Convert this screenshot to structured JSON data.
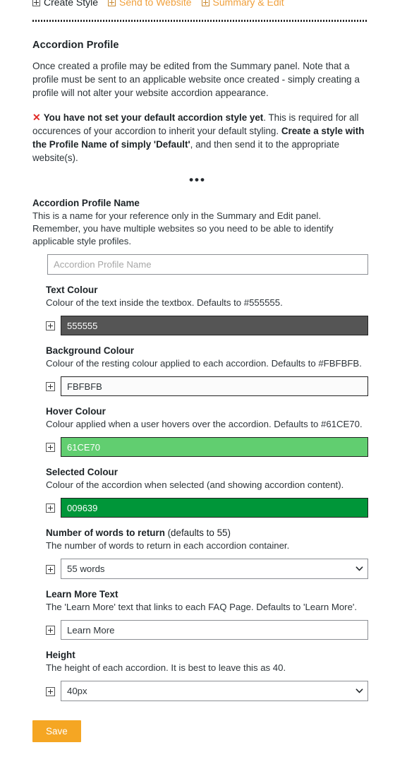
{
  "tabs": [
    {
      "label": "Create Style",
      "icon": "plus-box-icon",
      "active": true
    },
    {
      "label": "Send to Website",
      "icon": "plus-box-icon",
      "active": false
    },
    {
      "label": "Summary & Edit",
      "icon": "plus-box-icon",
      "active": false
    }
  ],
  "section": {
    "title": "Accordion Profile",
    "intro": "Once created a profile may be edited from the Summary panel. Note that a profile must be sent to an applicable website once created - simply creating a profile will not alter your website accordion appearance.",
    "divider_dots": "•••"
  },
  "alert": {
    "mark": "✕",
    "bold_1": "You have not set your default accordion style yet",
    "text_1": ". This is required for all occurences of your accordion to inherit your default styling. ",
    "bold_2": "Create a style with the Profile Name of simply 'Default'",
    "text_2": ", and then send it to the appropriate website(s)."
  },
  "fields": {
    "profile_name": {
      "label": "Accordion Profile Name",
      "help": "This is a name for your reference only in the Summary and Edit panel. Remember, you have multiple websites so you need to be able to identify applicable style profiles.",
      "placeholder": "Accordion Profile Name",
      "value": ""
    },
    "text_colour": {
      "label": "Text Colour",
      "help": "Colour of the text inside the textbox. Defaults to #555555.",
      "value": "555555",
      "swatch": "#555555",
      "text_colour": "#ffffff"
    },
    "background_colour": {
      "label": "Background Colour",
      "help": "Colour of the resting colour applied to each accordion. Defaults to #FBFBFB.",
      "value": "FBFBFB",
      "swatch": "#FBFBFB",
      "text_colour": "#2d3439"
    },
    "hover_colour": {
      "label": "Hover Colour",
      "help": "Colour applied when a user hovers over the accordion. Defaults to #61CE70.",
      "value": "61CE70",
      "swatch": "#61CE70",
      "text_colour": "#ffffff"
    },
    "selected_colour": {
      "label": "Selected Colour",
      "help": "Colour of the accordion when selected (and showing accordion content).",
      "value": "009639",
      "swatch": "#009639",
      "text_colour": "#ffffff"
    },
    "words": {
      "label_bold": "Number of words to return",
      "label_normal": " (defaults to 55)",
      "help": "The number of words to return in each accordion container.",
      "value": "55 words"
    },
    "learn_more": {
      "label": "Learn More Text",
      "help": "The 'Learn More' text that links to each FAQ Page. Defaults to 'Learn More'.",
      "value": "Learn More",
      "placeholder": ""
    },
    "height": {
      "label": "Height",
      "help": "The height of each accordion. It is best to leave this as 40.",
      "value": "40px"
    }
  },
  "actions": {
    "save_label": "Save",
    "save_colour": "#f5a623"
  }
}
